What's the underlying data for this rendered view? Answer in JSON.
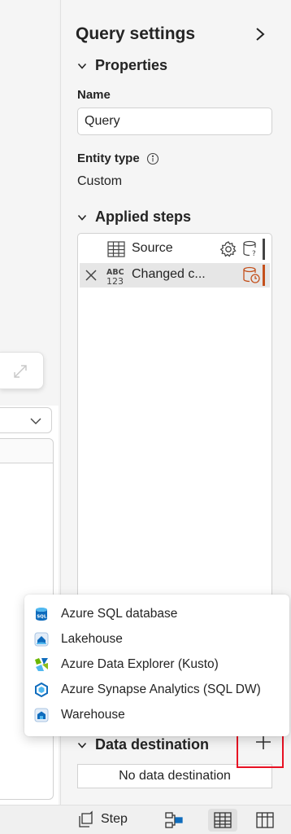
{
  "query_settings": {
    "title": "Query settings",
    "properties": {
      "header": "Properties",
      "name_label": "Name",
      "name_value": "Query",
      "entity_type_label": "Entity type",
      "entity_type_value": "Custom"
    },
    "applied_steps": {
      "header": "Applied steps",
      "steps": [
        {
          "label": "Source",
          "icon": "table-icon",
          "selected": false
        },
        {
          "label": "Changed c...",
          "icon": "abc-123-type-icon",
          "selected": true
        }
      ]
    },
    "data_destination": {
      "header": "Data destination",
      "value": "No data destination"
    }
  },
  "destination_menu": {
    "items": [
      {
        "label": "Azure SQL database",
        "icon": "azure-sql-icon"
      },
      {
        "label": "Lakehouse",
        "icon": "lakehouse-icon"
      },
      {
        "label": "Azure Data Explorer (Kusto)",
        "icon": "kusto-icon"
      },
      {
        "label": "Azure Synapse Analytics (SQL DW)",
        "icon": "synapse-icon"
      },
      {
        "label": "Warehouse",
        "icon": "warehouse-icon"
      }
    ]
  },
  "status_bar": {
    "step_label": "Step"
  },
  "colors": {
    "accent": "#0f6cbd",
    "warning": "#c4501b",
    "highlight_box": "#e81123"
  }
}
